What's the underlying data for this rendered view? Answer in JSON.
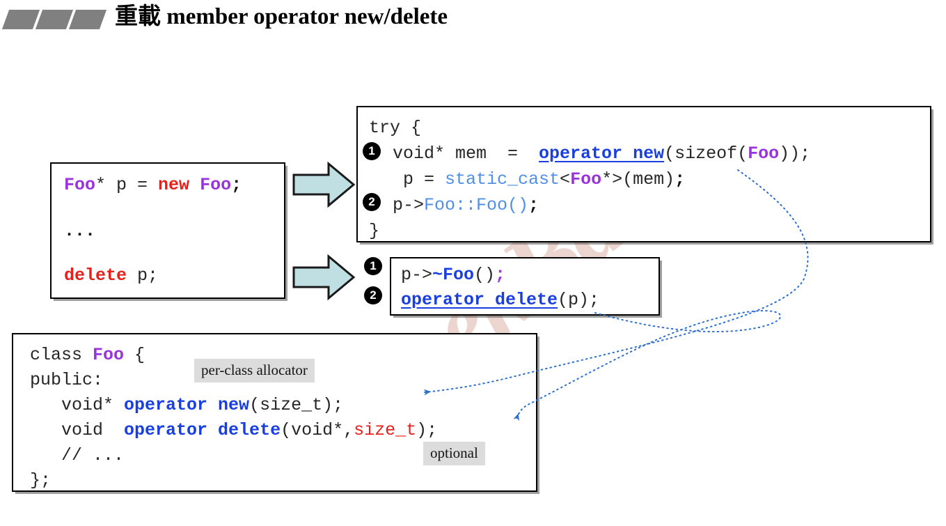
{
  "slide": {
    "title_cjk": "重載",
    "title_en": " member operator new/delete",
    "watermark": "GeekBand",
    "accent_colors": {
      "keyword_red": "#e8201c",
      "type_purple": "#9933dd",
      "operator_blue": "#1a3fe0",
      "light_blue": "#4f8fe8",
      "arrow_fill": "#bfdfe2",
      "marker_gray": "#808080",
      "callout_bg": "#dcdcdc",
      "watermark_pink": "#e8c8c0"
    }
  },
  "source_box": {
    "name": "new-delete-source",
    "lines": {
      "l1_type": "Foo",
      "l1_star_p": "* p = ",
      "l1_new": "new",
      "l1_space": " ",
      "l1_type2": "Foo",
      "l1_semi": ";",
      "l2_dots": "...",
      "l3_delete": "delete",
      "l3_rest": " p;"
    }
  },
  "try_box": {
    "name": "new-expansion",
    "l1": "try {",
    "l2_a": "void* mem  =  ",
    "l2_op": "operator new",
    "l2_b": "(sizeof(",
    "l2_type": "Foo",
    "l2_c": "));",
    "l3_a": " p = ",
    "l3_cast": "static_cast",
    "l3_lt": "<",
    "l3_type": "Foo",
    "l3_gt": "*>",
    "l3_mem": "(mem)",
    "l3_semi": ";",
    "l4_a": "p->",
    "l4_call": "Foo::Foo()",
    "l4_semi": ";",
    "l5": "}",
    "badges": [
      "1",
      "2"
    ]
  },
  "delete_box": {
    "name": "delete-expansion",
    "l1_a": "p->",
    "l1_tilde": "~Foo",
    "l1_b": "()",
    "l1_semi": ";",
    "l2_op": "operator delete",
    "l2_b": "(p);",
    "badges": [
      "1",
      "2"
    ]
  },
  "class_box": {
    "name": "class-foo-declaration",
    "l1_a": "class ",
    "l1_type": "Foo",
    "l1_b": " {",
    "l2": "public:",
    "l3_a": "   void* ",
    "l3_op": "operator new",
    "l3_b": "(size_t);",
    "l4_a": "   void  ",
    "l4_op": "operator delete",
    "l4_b": "(void*,",
    "l4_size": "size_t",
    "l4_c": ");",
    "l5": "   // ...",
    "l6": "};"
  },
  "callouts": {
    "per_class_allocator": "per-class allocator",
    "optional": "optional"
  },
  "arrows": {
    "to_new_expansion": "block-arrow-right",
    "to_delete_expansion": "block-arrow-right"
  }
}
